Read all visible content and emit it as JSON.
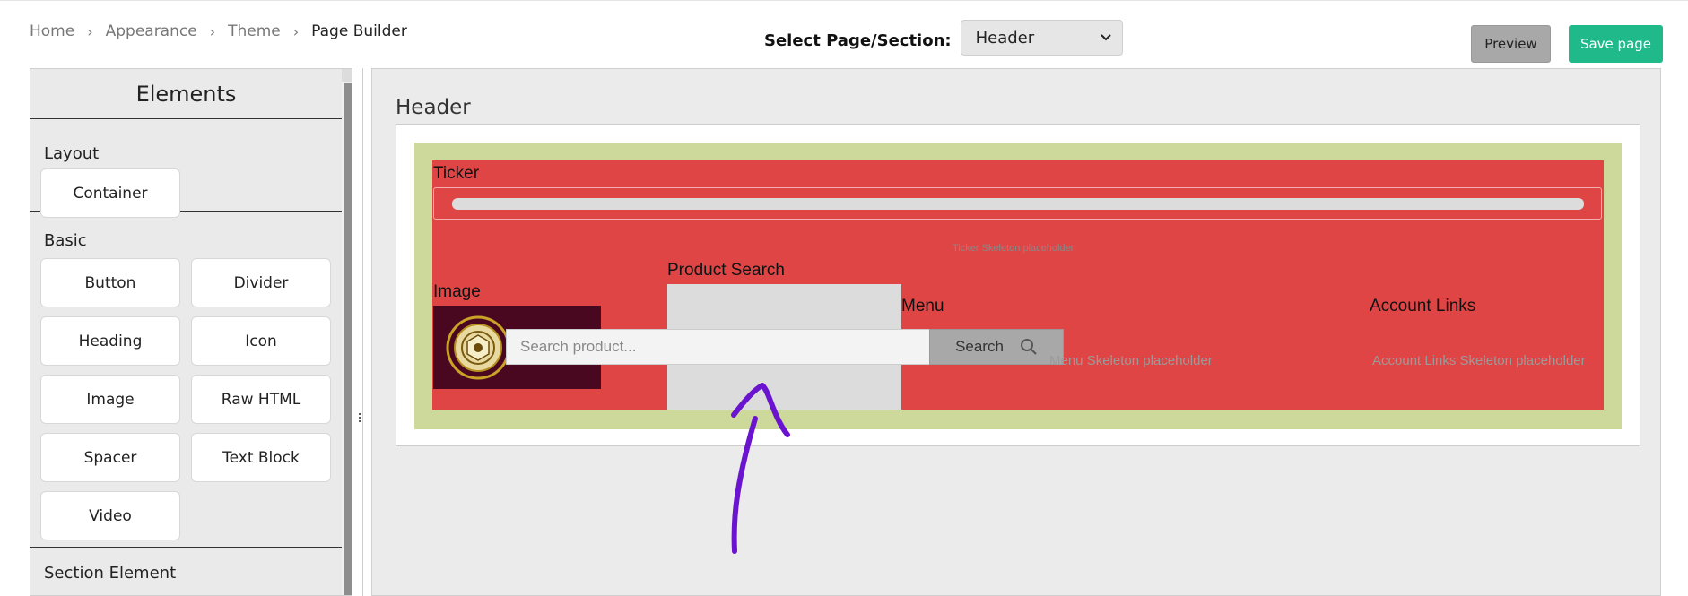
{
  "breadcrumb": {
    "items": [
      "Home",
      "Appearance",
      "Theme",
      "Page Builder"
    ]
  },
  "section_select": {
    "label": "Select Page/Section:",
    "value": "Header"
  },
  "actions": {
    "preview": "Preview",
    "save": "Save page"
  },
  "elements_panel": {
    "title": "Elements",
    "groups": [
      {
        "label": "Layout",
        "items": [
          "Container"
        ]
      },
      {
        "label": "Basic",
        "items": [
          "Button",
          "Divider",
          "Heading",
          "Icon",
          "Image",
          "Raw HTML",
          "Spacer",
          "Text Block",
          "Video"
        ]
      },
      {
        "label": "Section Element",
        "items": []
      }
    ]
  },
  "canvas": {
    "title": "Header",
    "ticker": {
      "label": "Ticker",
      "placeholder": "Ticker Skeleton placeholder"
    },
    "image": {
      "label": "Image"
    },
    "product_search": {
      "label": "Product Search",
      "placeholder": "Search product...",
      "button": "Search"
    },
    "menu": {
      "label": "Menu",
      "placeholder": "Menu Skeleton placeholder"
    },
    "account_links": {
      "label": "Account Links",
      "placeholder": "Account Links Skeleton placeholder"
    }
  },
  "colors": {
    "canvas_red": "#e04545",
    "canvas_green": "#cdd99a",
    "save_green": "#1fb98a",
    "annotation": "#6a14d0"
  },
  "icons": {
    "breadcrumb_sep": "chevron-right-icon",
    "select_caret": "chevron-down-icon",
    "search": "search-icon",
    "resize": "drag-handle-icon"
  }
}
